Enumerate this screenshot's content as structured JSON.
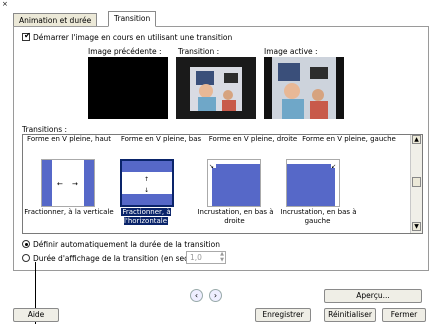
{
  "tabs": [
    {
      "label": "Animation et durée"
    },
    {
      "label": "Transition"
    }
  ],
  "start_checkbox": {
    "label": "Démarrer l'image en cours en utilisant une transition",
    "checked": true
  },
  "preview_labels": {
    "previous": "Image précédente :",
    "transition": "Transition :",
    "active": "Image active :"
  },
  "transitions_label": "Transitions :",
  "transitions": {
    "headers": [
      "Forme en  V pleine, haut",
      "Forme en V pleine, bas",
      "Forme en V pleine, droite",
      "Forme en V pleine, gauche"
    ],
    "items": [
      {
        "label": "Fractionner, à la verticale",
        "selected": false
      },
      {
        "label": "Fractionner, à l'horizontale",
        "selected": true
      },
      {
        "label": "Incrustation, en bas à droite",
        "selected": false
      },
      {
        "label": "Incrustation, en bas à gauche",
        "selected": false
      }
    ]
  },
  "radio_auto": {
    "label": "Définir automatiquement la durée de la transition",
    "selected": true
  },
  "radio_duration": {
    "label": "Durée d'affichage de la transition (en secondes)",
    "selected": false,
    "value": "1,0"
  },
  "buttons": {
    "help": "Aide",
    "preview": "Aperçu...",
    "save": "Enregistrer",
    "reset": "Réinitialiser",
    "close": "Fermer"
  },
  "colors": {
    "selection": "#0a246a",
    "tile_blue": "#5668c8"
  }
}
